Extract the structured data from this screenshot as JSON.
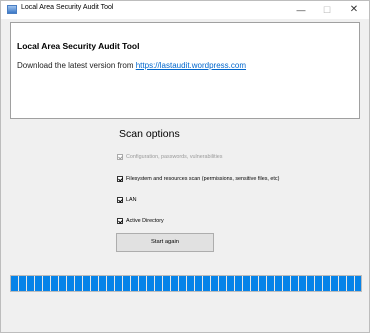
{
  "window": {
    "title": "Local Area Security Audit Tool",
    "minimize_glyph": "—",
    "maximize_glyph": "☐",
    "close_glyph": "✕"
  },
  "info": {
    "heading": "Local Area Security Audit Tool",
    "download_text": "Download the latest version from ",
    "download_link": "https://lastaudit.wordpress.com"
  },
  "scan": {
    "title": "Scan options",
    "options": [
      {
        "label": "Configuration, passwords, vulnerabilities",
        "checked": true,
        "enabled": false
      },
      {
        "label": "Filesystem and resources scan (permissions, sensitive files, etc)",
        "checked": true,
        "enabled": true
      },
      {
        "label": "LAN",
        "checked": true,
        "enabled": true
      },
      {
        "label": "Active Directory",
        "checked": true,
        "enabled": true
      }
    ],
    "start_button": "Start again"
  },
  "progress": {
    "value_percent": 100
  },
  "colors": {
    "progress_fill": "#0683e8",
    "link": "#0066cc"
  },
  "icons": {
    "app": "window-app-icon"
  }
}
